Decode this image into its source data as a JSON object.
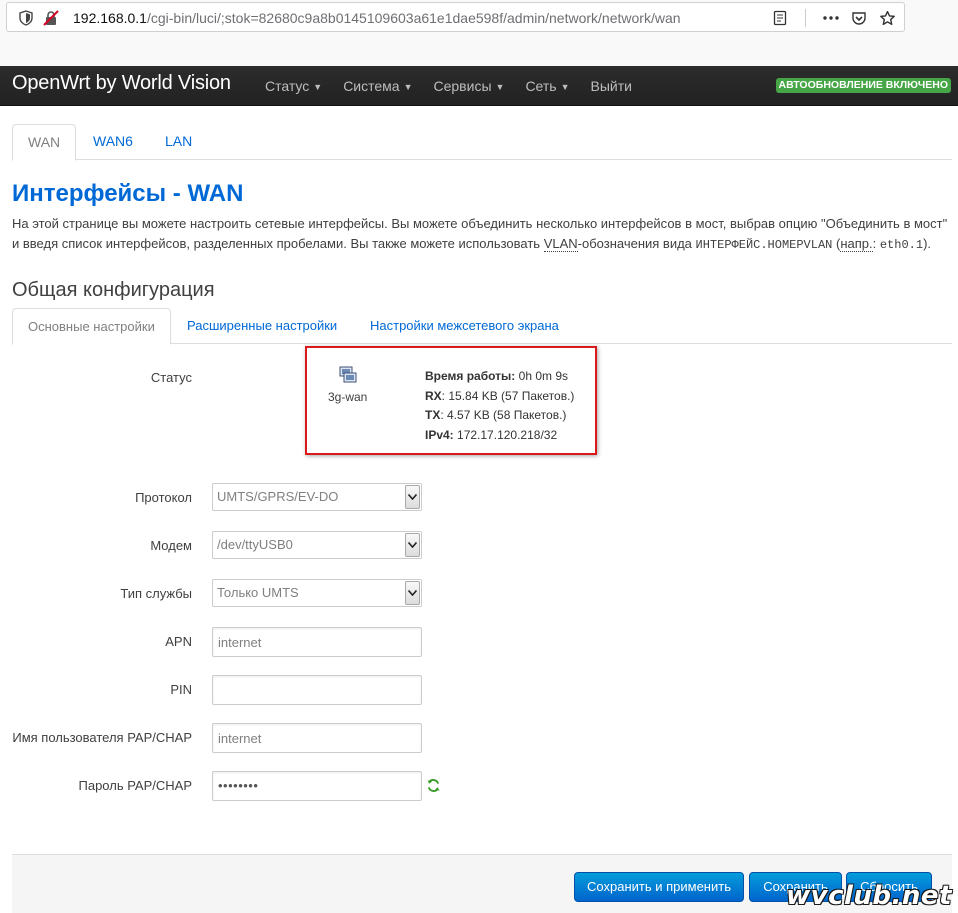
{
  "browser": {
    "url_host": "192.168.0.1",
    "url_path": "/cgi-bin/luci/;stok=82680c9a8b0145109603a61e1dae598f/admin/network/network/wan"
  },
  "navbar": {
    "brand": "OpenWrt by World Vision",
    "menu": [
      "Статус",
      "Система",
      "Сервисы",
      "Сеть",
      "Выйти"
    ],
    "badge": "АВТООБНОВЛЕНИЕ ВКЛЮЧЕНО",
    "badge_color": "#46a546"
  },
  "top_tabs": [
    "WAN",
    "WAN6",
    "LAN"
  ],
  "page": {
    "title": "Интерфейсы - WAN",
    "desc_part1": "На этой странице вы можете настроить сетевые интерфейсы. Вы можете объединить несколько интерфейсов в мост, выбрав опцию \"Объединить в мост\" и введя список интерфейсов, разделенных пробелами. Вы также можете использовать ",
    "desc_vlan": "VLAN",
    "desc_part2": "-обозначения вида ",
    "desc_code": "ИНТЕРФЕЙС.НОМЕРVLAN",
    "desc_part3": " (",
    "desc_abbr": "напр.",
    "desc_part4": ": ",
    "desc_code2": "eth0.1",
    "desc_part5": ")."
  },
  "section": {
    "title": "Общая конфигурация",
    "tabs": [
      "Основные настройки",
      "Расширенные настройки",
      "Настройки межсетевого экрана"
    ]
  },
  "status": {
    "label": "Статус",
    "iface": "3g-wan",
    "uptime_label": "Время работы:",
    "uptime_value": "0h 0m 9s",
    "rx_label": "RX",
    "rx_value": ": 15.84 KB (57 Пакетов.)",
    "tx_label": "TX",
    "tx_value": ": 4.57 KB (58 Пакетов.)",
    "ipv4_label": "IPv4:",
    "ipv4_value": "172.17.120.218/32"
  },
  "form": {
    "protocol": {
      "label": "Протокол",
      "value": "UMTS/GPRS/EV-DO"
    },
    "modem": {
      "label": "Модем",
      "value": "/dev/ttyUSB0"
    },
    "service": {
      "label": "Тип службы",
      "value": "Только UMTS"
    },
    "apn": {
      "label": "APN",
      "value": "internet"
    },
    "pin": {
      "label": "PIN",
      "value": ""
    },
    "user": {
      "label": "Имя пользователя PAP/CHAP",
      "value": "internet"
    },
    "password": {
      "label": "Пароль PAP/CHAP",
      "masked": "••••••••"
    }
  },
  "actions": {
    "save_apply": "Сохранить и применить",
    "save": "Сохранить",
    "reset": "Сбросить"
  },
  "watermark": "wvclub.net"
}
